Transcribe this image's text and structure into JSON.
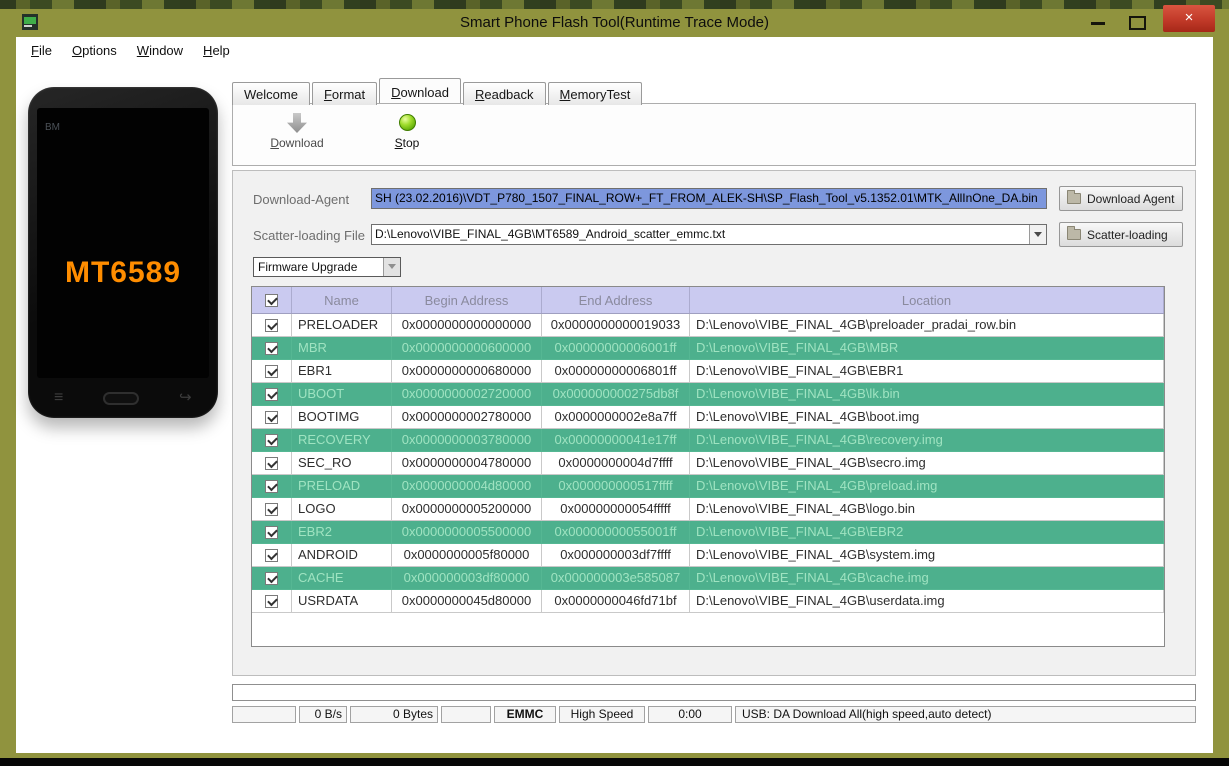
{
  "window": {
    "title": "Smart Phone Flash Tool(Runtime Trace Mode)",
    "close_glyph": "×"
  },
  "menu": {
    "items": [
      {
        "dname": "menu-item-file",
        "label": "File",
        "accel": true
      },
      {
        "dname": "menu-item-options",
        "label": "Options",
        "accel": true
      },
      {
        "dname": "menu-item-window",
        "label": "Window",
        "accel": true
      },
      {
        "dname": "menu-item-help",
        "label": "Help",
        "accel": true
      }
    ]
  },
  "phone": {
    "brand": "BM",
    "chip": "MT6589",
    "menu_glyph": "≡",
    "back_glyph": "↩"
  },
  "tabs": [
    {
      "dname": "tab-welcome",
      "label": "Welcome"
    },
    {
      "dname": "tab-format",
      "label": "Format",
      "accel": true
    },
    {
      "dname": "tab-download",
      "label": "Download",
      "active": true,
      "accel": true
    },
    {
      "dname": "tab-readback",
      "label": "Readback",
      "accel": true
    },
    {
      "dname": "tab-memorytest",
      "label": "MemoryTest",
      "accel": true
    }
  ],
  "toolbar": {
    "download_label": "Download",
    "stop_label": "Stop"
  },
  "form": {
    "download_agent_label": "Download-Agent",
    "download_agent_value": "SH (23.02.2016)\\VDT_P780_1507_FINAL_ROW+_FT_FROM_ALEK-SH\\SP_Flash_Tool_v5.1352.01\\MTK_AllInOne_DA.bin",
    "download_agent_button": "Download Agent",
    "scatter_label": "Scatter-loading File",
    "scatter_value": "D:\\Lenovo\\VIBE_FINAL_4GB\\MT6589_Android_scatter_emmc.txt",
    "scatter_button": "Scatter-loading",
    "mode_value": "Firmware Upgrade"
  },
  "table": {
    "headers": [
      "Name",
      "Begin Address",
      "End Address",
      "Location"
    ],
    "rows": [
      {
        "name": "PRELOADER",
        "begin": "0x0000000000000000",
        "end": "0x0000000000019033",
        "location": "D:\\Lenovo\\VIBE_FINAL_4GB\\preloader_pradai_row.bin",
        "checked": true,
        "highlight": false
      },
      {
        "name": "MBR",
        "begin": "0x0000000000600000",
        "end": "0x00000000006001ff",
        "location": "D:\\Lenovo\\VIBE_FINAL_4GB\\MBR",
        "checked": true,
        "highlight": true
      },
      {
        "name": "EBR1",
        "begin": "0x0000000000680000",
        "end": "0x00000000006801ff",
        "location": "D:\\Lenovo\\VIBE_FINAL_4GB\\EBR1",
        "checked": true,
        "highlight": false
      },
      {
        "name": "UBOOT",
        "begin": "0x0000000002720000",
        "end": "0x000000000275db8f",
        "location": "D:\\Lenovo\\VIBE_FINAL_4GB\\lk.bin",
        "checked": true,
        "highlight": true
      },
      {
        "name": "BOOTIMG",
        "begin": "0x0000000002780000",
        "end": "0x0000000002e8a7ff",
        "location": "D:\\Lenovo\\VIBE_FINAL_4GB\\boot.img",
        "checked": true,
        "highlight": false
      },
      {
        "name": "RECOVERY",
        "begin": "0x0000000003780000",
        "end": "0x00000000041e17ff",
        "location": "D:\\Lenovo\\VIBE_FINAL_4GB\\recovery.img",
        "checked": true,
        "highlight": true
      },
      {
        "name": "SEC_RO",
        "begin": "0x0000000004780000",
        "end": "0x0000000004d7ffff",
        "location": "D:\\Lenovo\\VIBE_FINAL_4GB\\secro.img",
        "checked": true,
        "highlight": false
      },
      {
        "name": "PRELOAD",
        "begin": "0x0000000004d80000",
        "end": "0x000000000517ffff",
        "location": "D:\\Lenovo\\VIBE_FINAL_4GB\\preload.img",
        "checked": true,
        "highlight": true
      },
      {
        "name": "LOGO",
        "begin": "0x0000000005200000",
        "end": "0x00000000054fffff",
        "location": "D:\\Lenovo\\VIBE_FINAL_4GB\\logo.bin",
        "checked": true,
        "highlight": false
      },
      {
        "name": "EBR2",
        "begin": "0x0000000005500000",
        "end": "0x00000000055001ff",
        "location": "D:\\Lenovo\\VIBE_FINAL_4GB\\EBR2",
        "checked": true,
        "highlight": true
      },
      {
        "name": "ANDROID",
        "begin": "0x0000000005f80000",
        "end": "0x000000003df7ffff",
        "location": "D:\\Lenovo\\VIBE_FINAL_4GB\\system.img",
        "checked": true,
        "highlight": false
      },
      {
        "name": "CACHE",
        "begin": "0x000000003df80000",
        "end": "0x000000003e585087",
        "location": "D:\\Lenovo\\VIBE_FINAL_4GB\\cache.img",
        "checked": true,
        "highlight": true
      },
      {
        "name": "USRDATA",
        "begin": "0x0000000045d80000",
        "end": "0x0000000046fd71bf",
        "location": "D:\\Lenovo\\VIBE_FINAL_4GB\\userdata.img",
        "checked": true,
        "highlight": false
      }
    ]
  },
  "status": {
    "cells": [
      {
        "dname": "status-cell-blank-1",
        "label": ""
      },
      {
        "dname": "status-cell-speed",
        "label": "0 B/s"
      },
      {
        "dname": "status-cell-bytes",
        "label": "0 Bytes"
      },
      {
        "dname": "status-cell-blank-2",
        "label": ""
      },
      {
        "dname": "status-cell-storage",
        "label": "EMMC",
        "bold": true
      },
      {
        "dname": "status-cell-usb-speed",
        "label": "High Speed"
      },
      {
        "dname": "status-cell-time",
        "label": "0:00"
      },
      {
        "dname": "status-cell-usb-mode",
        "label": "USB: DA Download All(high speed,auto detect)"
      }
    ]
  },
  "colors": {
    "frame_olive": "#90933e",
    "chip_orange": "#ff8d00",
    "selection_blue": "#7d97dd",
    "header_lavender": "#cacaf0",
    "header_text": "#8a8a9e",
    "row_green": "#4db08d",
    "row_green_text": "#9fe3c1",
    "panel_gray": "#f1f1f1",
    "close_red": "#c23a29"
  }
}
